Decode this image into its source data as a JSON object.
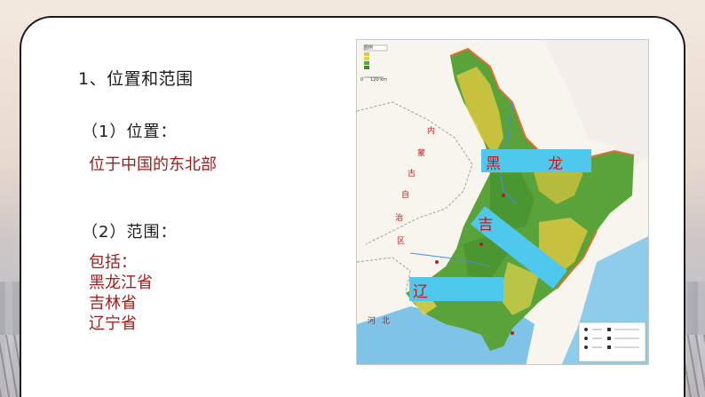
{
  "slide": {
    "heading": "1、位置和范围",
    "location_heading": "（1）位置：",
    "location_text": "位于中国的东北部",
    "scope_heading": "（2）范围：",
    "scope_lines": [
      "包括：",
      "黑龙江省",
      "吉林省",
      "辽宁省"
    ]
  },
  "map": {
    "labels": {
      "heilongjiang": [
        "黑",
        "龙"
      ],
      "jilin": "吉",
      "liaoning": "辽"
    },
    "neighbor_labels": [
      "内",
      "蒙",
      "古",
      "自",
      "治",
      "区",
      "河",
      "北"
    ],
    "legend_title": "图例",
    "scale": "0     120 km",
    "colors": {
      "label_box": "#4fc8ee",
      "label_text": "#c81818",
      "plain": "#5aa33a",
      "mountain": "#d8c93a",
      "sea": "#7fc3e8"
    }
  }
}
